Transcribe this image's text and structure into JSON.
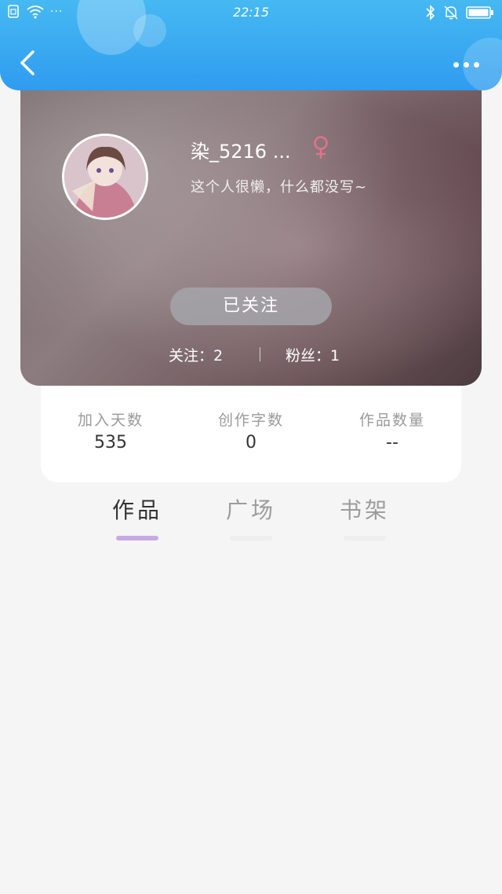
{
  "status_bar": {
    "time": "22:15",
    "left_dots": "···",
    "icons": [
      "sim-icon",
      "wifi-icon",
      "bluetooth-icon",
      "bell-muted-icon",
      "battery-icon"
    ]
  },
  "profile": {
    "username": "染_5216 ...",
    "gender_symbol": "♀",
    "bio": "这个人很懒，什么都没写~",
    "follow_button": "已关注",
    "following_text": "关注：2",
    "fans_text": "粉丝：1"
  },
  "stats": [
    {
      "label": "加入天数",
      "value": "535"
    },
    {
      "label": "创作字数",
      "value": "0"
    },
    {
      "label": "作品数量",
      "value": "--"
    }
  ],
  "tabs": [
    {
      "label": "作品",
      "active": true
    },
    {
      "label": "广场",
      "active": false
    },
    {
      "label": "书架",
      "active": false
    }
  ],
  "colors": {
    "header": "#3aaaf2",
    "tab_active_underline": "#c8a9e6",
    "gender": "#e0738a"
  }
}
